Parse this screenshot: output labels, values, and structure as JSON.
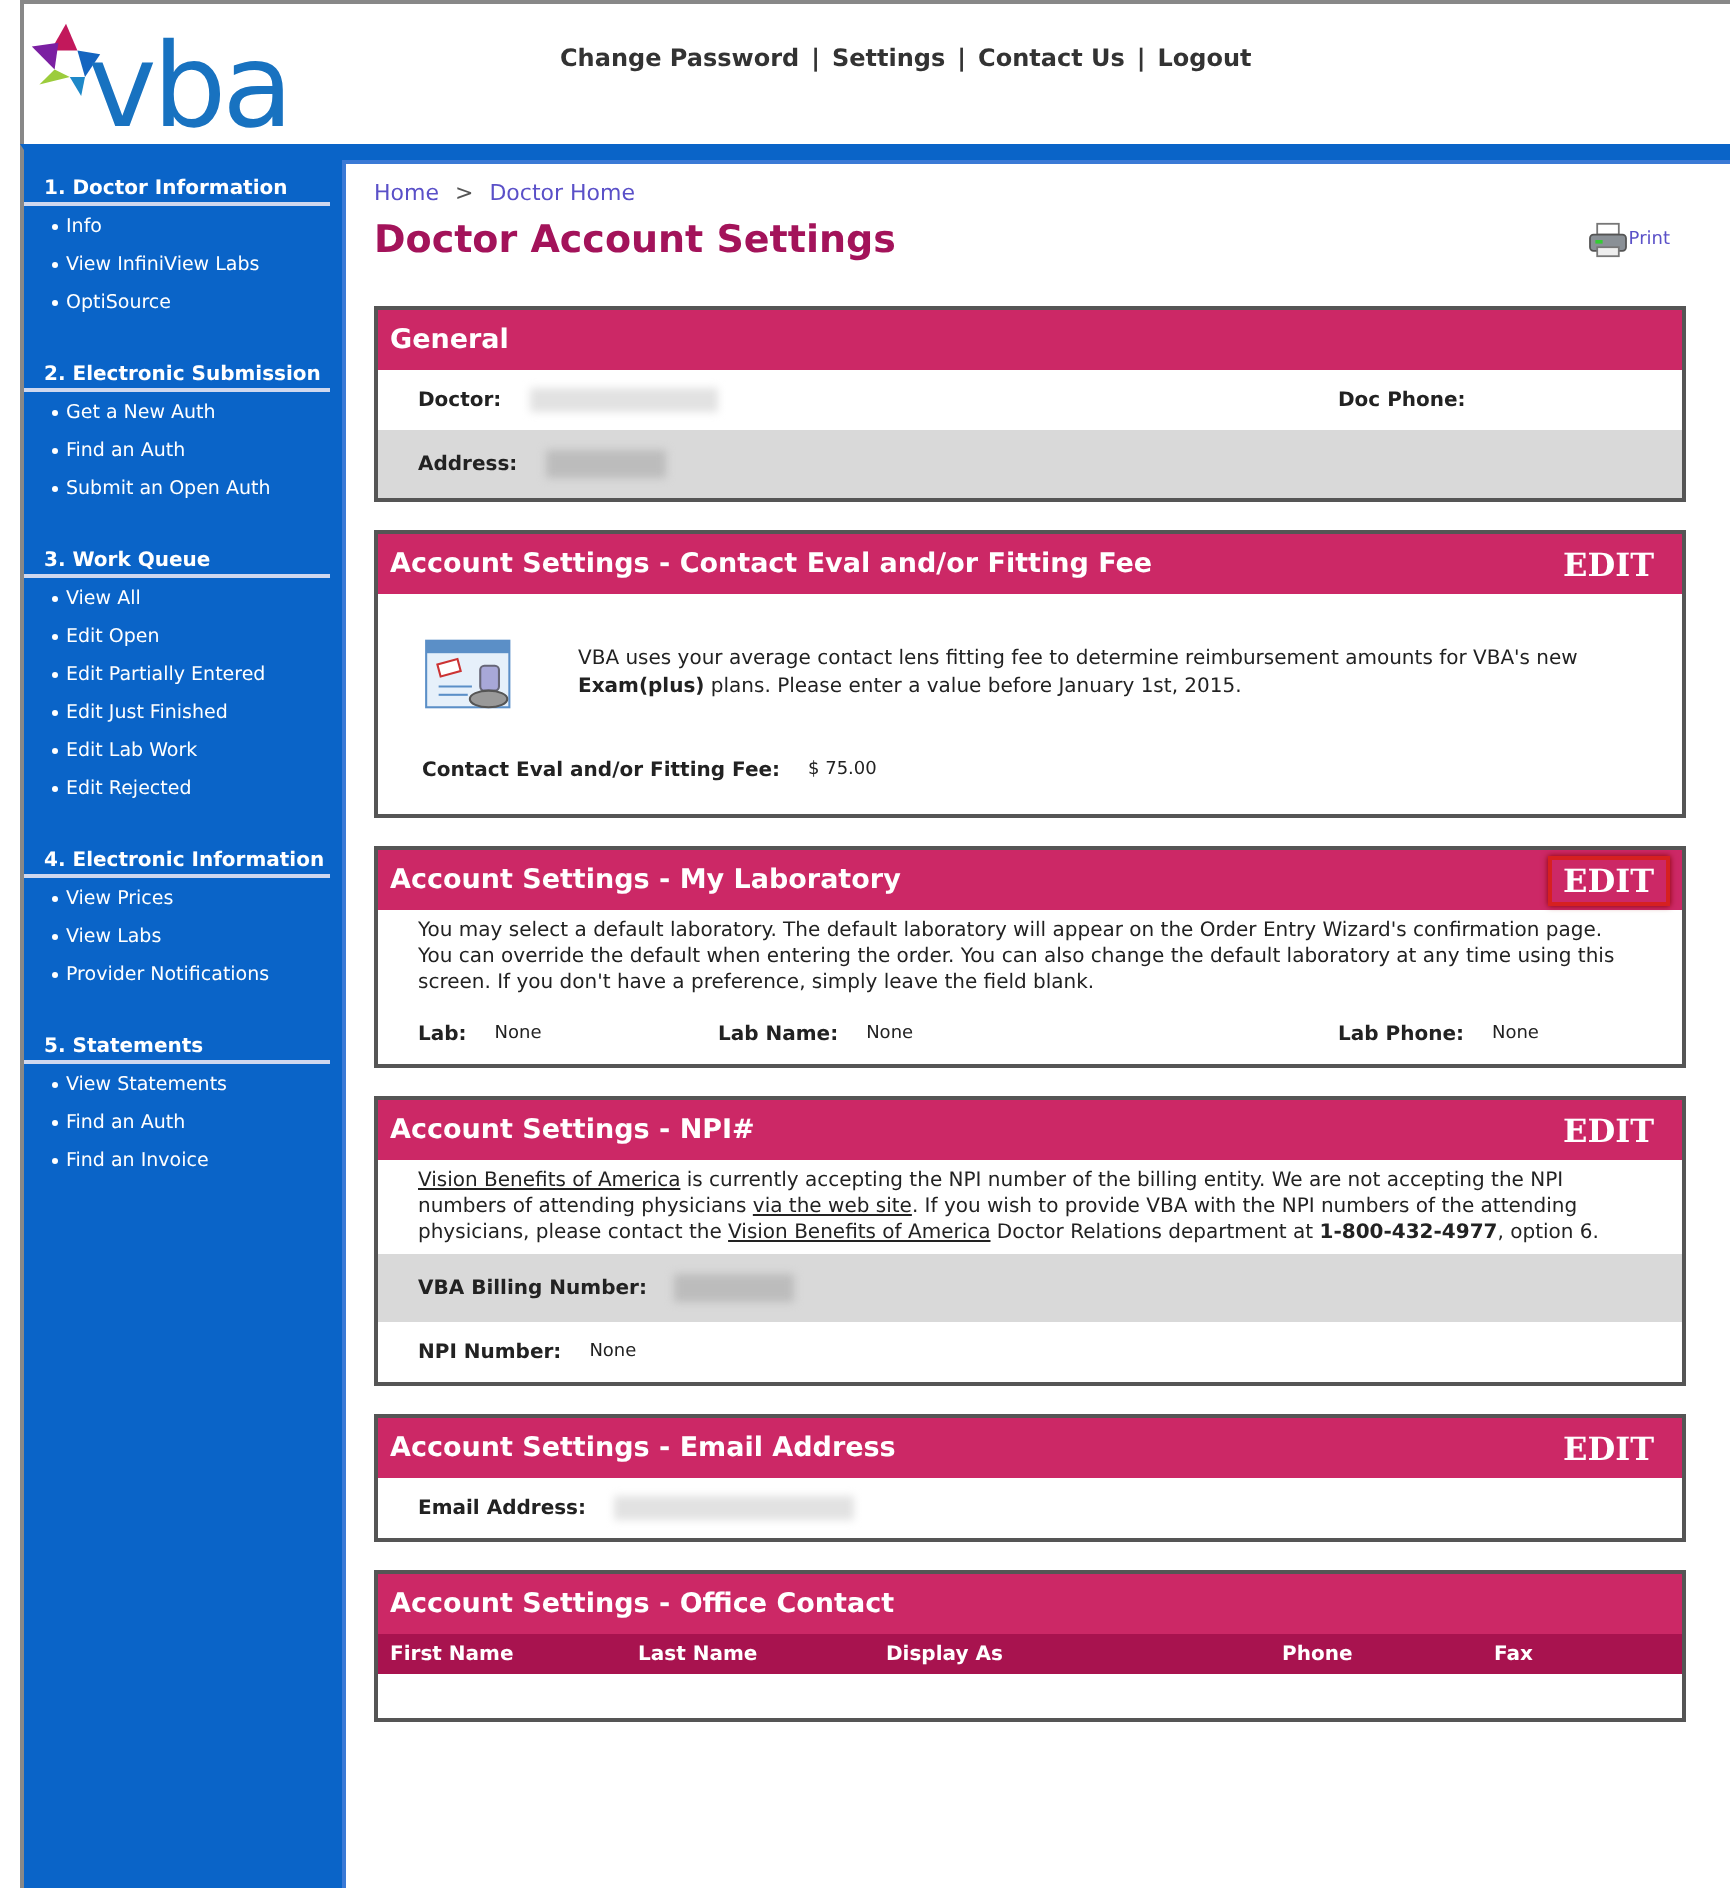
{
  "header": {
    "links": [
      "Change Password",
      "Settings",
      "Contact Us",
      "Logout"
    ],
    "separator": "|",
    "logo_text": "vba"
  },
  "sidebar": {
    "groups": [
      {
        "title": "1. Doctor Information",
        "items": [
          "Info",
          "View InfiniView Labs",
          "OptiSource"
        ]
      },
      {
        "title": "2. Electronic Submission",
        "items": [
          "Get a New Auth",
          "Find an Auth",
          "Submit an Open Auth"
        ]
      },
      {
        "title": "3. Work Queue",
        "items": [
          "View All",
          "Edit Open",
          "Edit Partially Entered",
          "Edit Just Finished",
          "Edit Lab Work",
          "Edit Rejected"
        ]
      },
      {
        "title": "4. Electronic Information",
        "items": [
          "View Prices",
          "View Labs",
          "Provider Notifications"
        ]
      },
      {
        "title": "5. Statements",
        "items": [
          "View Statements",
          "Find an Auth",
          "Find an Invoice"
        ]
      }
    ]
  },
  "breadcrumb": {
    "items": [
      "Home",
      "Doctor Home"
    ],
    "separator": ">"
  },
  "page_title": "Doctor Account Settings",
  "print_label": "Print",
  "sections": [
    {
      "title": "General",
      "blocks": [
        {
          "kind": "fields",
          "shaded": false,
          "fields": [
            {
              "label": "Doctor:",
              "redacted": true
            },
            {
              "label": "Doc Phone:"
            }
          ]
        },
        {
          "kind": "fields",
          "shaded": true,
          "fields": [
            {
              "label": "Address:",
              "redacted": true
            }
          ]
        }
      ]
    },
    {
      "title": "Account Settings - Contact Eval and/or Fitting Fee",
      "edit": {
        "label": "EDIT",
        "highlighted": false
      },
      "blocks": [
        {
          "kind": "icon_text",
          "text": "VBA uses your average contact lens fitting fee to determine reimbursement amounts for VBA's new **Exam(plus)** plans. Please enter a value before January 1st, 2015."
        },
        {
          "kind": "fields",
          "shaded": false,
          "fields": [
            {
              "label": "Contact Eval and/or Fitting Fee:",
              "value": "$ 75.00"
            }
          ]
        }
      ]
    },
    {
      "title": "Account Settings - My Laboratory",
      "edit": {
        "label": "EDIT",
        "highlighted": true
      },
      "blocks": [
        {
          "kind": "note",
          "segments": [
            {
              "text": "You may select a default laboratory. The default laboratory will appear on the Order Entry Wizard's confirmation page. You can override the default when entering the order. You can also change the default laboratory at any time using this screen. If you don't have a preference, simply leave the field blank.",
              "link": false
            }
          ]
        },
        {
          "kind": "fields",
          "shaded": false,
          "fields": [
            {
              "label": "Lab:",
              "value": "None"
            },
            {
              "label": "Lab Name:",
              "value": "None"
            },
            {
              "label": "Lab Phone:",
              "value": "None"
            }
          ]
        }
      ]
    },
    {
      "title": "Account Settings - NPI#",
      "edit": {
        "label": "EDIT",
        "highlighted": false
      },
      "blocks": [
        {
          "kind": "note",
          "segments": [
            {
              "text": "Vision Benefits of America",
              "link": true
            },
            {
              "text": " is currently accepting the NPI number of the billing entity. We are not accepting the NPI numbers of attending physicians ",
              "link": false
            },
            {
              "text": "via the web site",
              "link": true
            },
            {
              "text": ". If you wish to provide VBA with the NPI numbers of the attending physicians, please contact the ",
              "link": false
            },
            {
              "text": "Vision Benefits of America",
              "link": true
            },
            {
              "text": " Doctor Relations department at **1-800-432-4977**, option 6.",
              "link": false
            }
          ]
        },
        {
          "kind": "fields",
          "shaded": true,
          "fields": [
            {
              "label": "VBA Billing Number:",
              "redacted": true
            }
          ]
        },
        {
          "kind": "fields",
          "shaded": false,
          "fields": [
            {
              "label": "NPI Number:",
              "value": "None"
            }
          ]
        }
      ]
    },
    {
      "title": "Account Settings - Email Address",
      "edit": {
        "label": "EDIT",
        "highlighted": false
      },
      "blocks": [
        {
          "kind": "fields",
          "shaded": false,
          "fields": [
            {
              "label": "Email Address:",
              "redacted": true
            }
          ]
        }
      ]
    },
    {
      "title": "Account Settings - Office Contact",
      "blocks": [
        {
          "kind": "table",
          "columns": [
            "First Name",
            "Last Name",
            "Display As",
            "Phone",
            "Fax"
          ]
        }
      ]
    }
  ]
}
